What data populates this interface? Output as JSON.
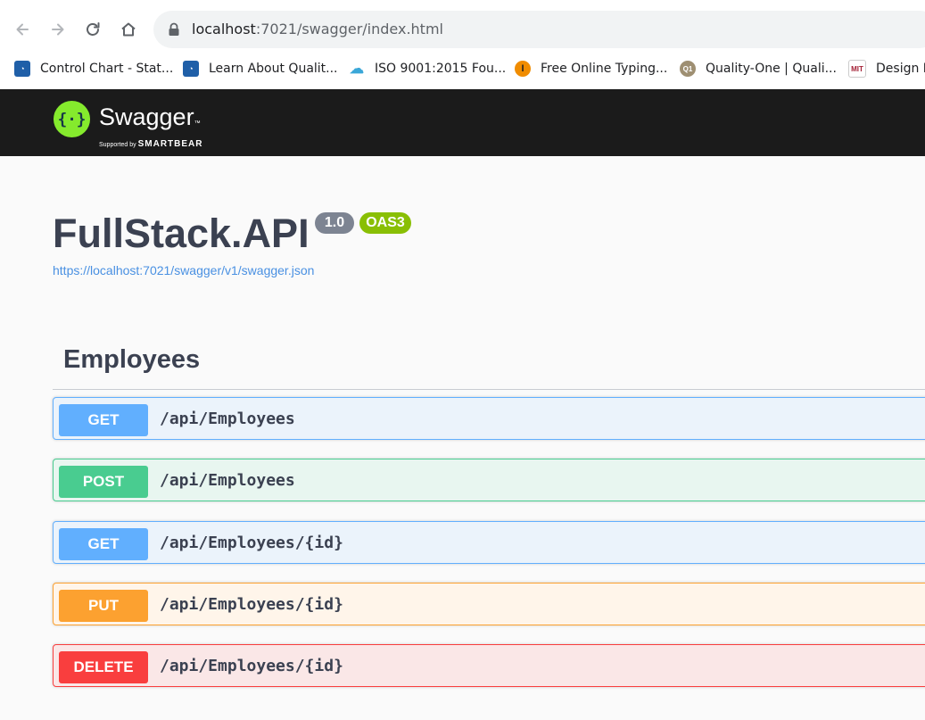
{
  "browser": {
    "url_host": "localhost",
    "url_path": ":7021/swagger/index.html",
    "bookmarks": [
      {
        "label": "Control Chart - Stat...",
        "icon": "bookmark-blue-logo-icon",
        "color": "#1f5fa8"
      },
      {
        "label": "Learn About Qualit...",
        "icon": "bookmark-blue-logo-icon",
        "color": "#1f5fa8"
      },
      {
        "label": "ISO 9001:2015 Fou...",
        "icon": "bookmark-cloud-icon",
        "color": "#3aa7d8"
      },
      {
        "label": "Free Online Typing...",
        "icon": "bookmark-orange-typing-icon",
        "color": "#f08c00"
      },
      {
        "label": "Quality-One | Quali...",
        "icon": "bookmark-q1-icon",
        "color": "#9e8f72"
      },
      {
        "label": "Design H",
        "icon": "bookmark-mit-icon",
        "color": "#a31f34"
      }
    ]
  },
  "topbar": {
    "logo_text": "Swagger",
    "tm": "™",
    "sub_prefix": "Supported by ",
    "sub_brand": "SMARTBEAR",
    "bg_color": "#1b1b1b",
    "logo_color": "#85ea2d"
  },
  "info": {
    "title": "FullStack.API",
    "version": "1.0",
    "oas": "OAS3",
    "spec_link": "https://localhost:7021/swagger/v1/swagger.json"
  },
  "tag": {
    "name": "Employees",
    "operations": [
      {
        "method": "GET",
        "path": "/api/Employees",
        "method_color": "#61affe",
        "bg": "#ebf3fb",
        "border": "#61affe"
      },
      {
        "method": "POST",
        "path": "/api/Employees",
        "method_color": "#49cc90",
        "bg": "#e8f6f0",
        "border": "#49cc90"
      },
      {
        "method": "GET",
        "path": "/api/Employees/{id}",
        "method_color": "#61affe",
        "bg": "#ebf3fb",
        "border": "#61affe"
      },
      {
        "method": "PUT",
        "path": "/api/Employees/{id}",
        "method_color": "#fca130",
        "bg": "#fff5ea",
        "border": "#fca130"
      },
      {
        "method": "DELETE",
        "path": "/api/Employees/{id}",
        "method_color": "#f93e3e",
        "bg": "#fae7e7",
        "border": "#f93e3e"
      }
    ]
  }
}
